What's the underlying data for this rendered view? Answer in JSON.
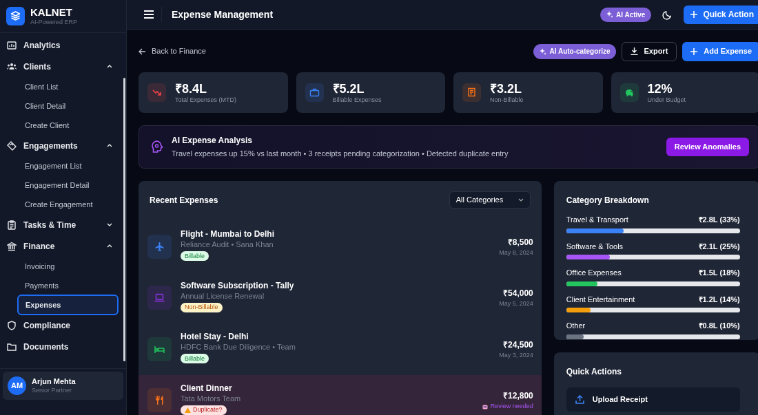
{
  "brand": {
    "name": "KALNET",
    "tagline": "AI-Powered ERP"
  },
  "sidebar": {
    "items": [
      {
        "label": "Analytics"
      },
      {
        "label": "Clients",
        "expanded": true,
        "children": [
          {
            "label": "Client List",
            "selected": false
          },
          {
            "label": "Client Detail",
            "selected": false
          },
          {
            "label": "Create Client",
            "selected": false
          }
        ]
      },
      {
        "label": "Engagements",
        "expanded": true,
        "children": [
          {
            "label": "Engagement List",
            "selected": false
          },
          {
            "label": "Engagement Detail",
            "selected": false
          },
          {
            "label": "Create Engagement",
            "selected": false
          }
        ]
      },
      {
        "label": "Tasks & Time",
        "expanded": false
      },
      {
        "label": "Finance",
        "expanded": true,
        "children": [
          {
            "label": "Invoicing",
            "selected": false
          },
          {
            "label": "Payments",
            "selected": false
          },
          {
            "label": "Expenses",
            "selected": true
          }
        ]
      },
      {
        "label": "Compliance"
      },
      {
        "label": "Documents"
      }
    ]
  },
  "user": {
    "initials": "AM",
    "name": "Arjun Mehta",
    "role": "Senior Partner"
  },
  "header": {
    "title": "Expense Management",
    "ai_badge": "AI Active",
    "quick_action": "Quick Action"
  },
  "toolbar": {
    "back": "Back to Finance",
    "auto_categorize": "AI Auto-categorize",
    "export": "Export",
    "add": "Add Expense"
  },
  "stats": [
    {
      "value": "₹8.4L",
      "label": "Total Expenses (MTD)",
      "color": "#ef4444"
    },
    {
      "value": "₹5.2L",
      "label": "Billable Expenses",
      "color": "#3b82f6"
    },
    {
      "value": "₹3.2L",
      "label": "Non-Billable",
      "color": "#f97316"
    },
    {
      "value": "12%",
      "label": "Under Budget",
      "color": "#22c55e"
    }
  ],
  "analysis": {
    "title": "AI Expense Analysis",
    "text": "Travel expenses up 15% vs last month • 3 receipts pending categorization • Detected duplicate entry",
    "button": "Review Anomalies"
  },
  "recent": {
    "title": "Recent Expenses",
    "filter": "All Categories",
    "rows": [
      {
        "title": "Flight - Mumbai to Delhi",
        "subtitle": "Reliance Audit • Sana Khan",
        "tag": "Billable",
        "kind": "billable",
        "amount": "₹8,500",
        "date": "May 8, 2024",
        "color": "#3b82f6",
        "flagged": false
      },
      {
        "title": "Software Subscription - Tally",
        "subtitle": "Annual License Renewal",
        "tag": "Non-Billable",
        "kind": "non-billable",
        "amount": "₹54,000",
        "date": "May 5, 2024",
        "color": "#9333ea",
        "flagged": false
      },
      {
        "title": "Hotel Stay - Delhi",
        "subtitle": "HDFC Bank Due Diligence • Team",
        "tag": "Billable",
        "kind": "billable",
        "amount": "₹24,500",
        "date": "May 3, 2024",
        "color": "#22c55e",
        "flagged": false
      },
      {
        "title": "Client Dinner",
        "subtitle": "Tata Motors Team",
        "tag": "Duplicate?",
        "kind": "duplicate",
        "amount": "₹12,800",
        "note": "Review needed",
        "color": "#f97316",
        "flagged": true
      }
    ]
  },
  "breakdown": {
    "title": "Category Breakdown",
    "items": [
      {
        "label": "Travel & Transport",
        "reading": "₹2.8L (33%)",
        "level": 0.33,
        "color": "#3b82f6"
      },
      {
        "label": "Software & Tools",
        "reading": "₹2.1L (25%)",
        "level": 0.25,
        "color": "#a855f7"
      },
      {
        "label": "Office Expenses",
        "reading": "₹1.5L (18%)",
        "level": 0.18,
        "color": "#22c55e"
      },
      {
        "label": "Client Entertainment",
        "reading": "₹1.2L (14%)",
        "level": 0.14,
        "color": "#f59e0b"
      },
      {
        "label": "Other",
        "reading": "₹0.8L (10%)",
        "level": 0.1,
        "color": "#6b7280"
      }
    ]
  },
  "quick_actions": {
    "title": "Quick Actions",
    "items": [
      {
        "label": "Upload Receipt"
      }
    ]
  }
}
